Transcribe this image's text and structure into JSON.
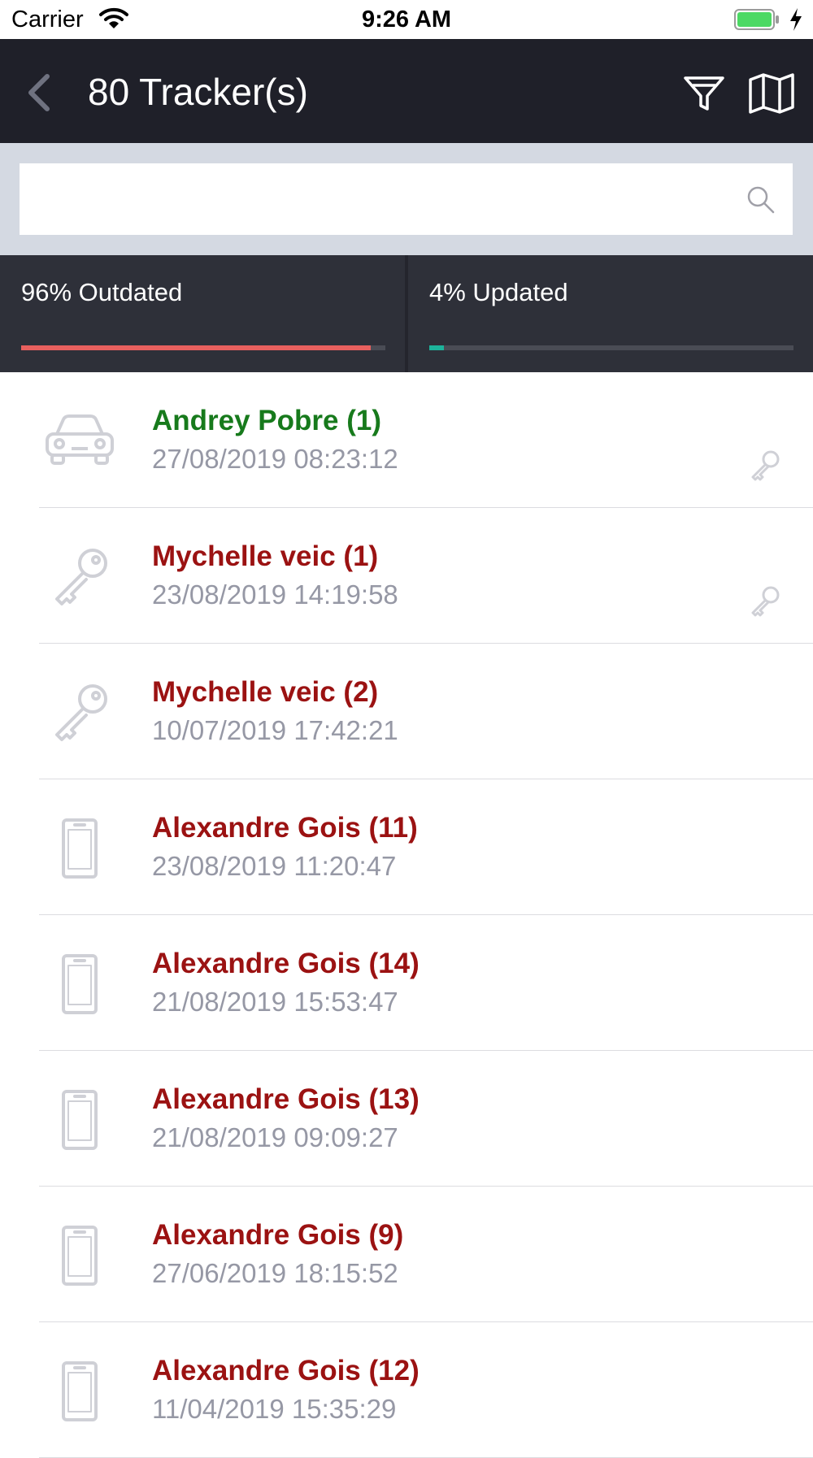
{
  "status_bar": {
    "carrier": "Carrier",
    "time": "9:26 AM"
  },
  "header": {
    "title": "80 Tracker(s)"
  },
  "search": {
    "placeholder": "",
    "value": ""
  },
  "stats": {
    "outdated": {
      "label": "96% Outdated",
      "percent": 96,
      "color": "#e8605e"
    },
    "updated": {
      "label": "4% Updated",
      "percent": 4,
      "color": "#1db39b"
    }
  },
  "colors": {
    "online": "#177a1c",
    "offline": "#9b1212"
  },
  "trackers": [
    {
      "name": "Andrey Pobre (1)",
      "date": "27/08/2019 08:23:12",
      "status": "online",
      "icon": "car-icon",
      "has_key": true
    },
    {
      "name": "Mychelle veic (1)",
      "date": "23/08/2019 14:19:58",
      "status": "offline",
      "icon": "key-icon",
      "has_key": true
    },
    {
      "name": "Mychelle veic (2)",
      "date": "10/07/2019 17:42:21",
      "status": "offline",
      "icon": "key-icon",
      "has_key": false
    },
    {
      "name": "Alexandre Gois (11)",
      "date": "23/08/2019 11:20:47",
      "status": "offline",
      "icon": "phone-icon",
      "has_key": false
    },
    {
      "name": "Alexandre Gois (14)",
      "date": "21/08/2019 15:53:47",
      "status": "offline",
      "icon": "phone-icon",
      "has_key": false
    },
    {
      "name": "Alexandre Gois (13)",
      "date": "21/08/2019 09:09:27",
      "status": "offline",
      "icon": "phone-icon",
      "has_key": false
    },
    {
      "name": "Alexandre Gois (9)",
      "date": "27/06/2019 18:15:52",
      "status": "offline",
      "icon": "phone-icon",
      "has_key": false
    },
    {
      "name": "Alexandre Gois (12)",
      "date": "11/04/2019 15:35:29",
      "status": "offline",
      "icon": "phone-icon",
      "has_key": false
    }
  ]
}
